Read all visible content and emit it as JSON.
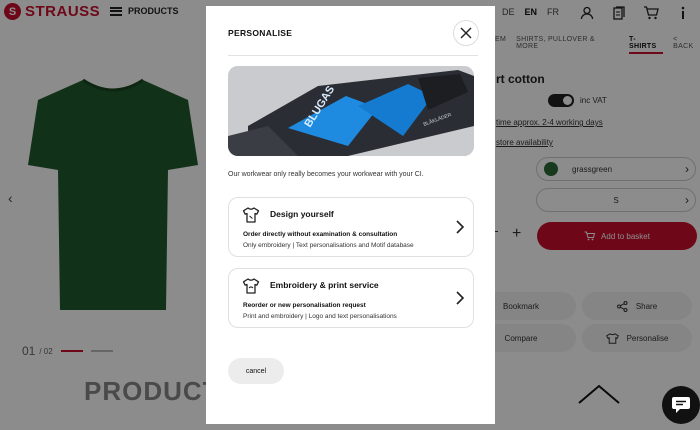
{
  "header": {
    "logo_mark": "S",
    "logo_text": "STRAUSS",
    "menu_label": "PRODUCTS",
    "languages": [
      {
        "label": "DE",
        "active": false
      },
      {
        "label": "EN",
        "active": true
      },
      {
        "label": "FR",
        "active": false
      }
    ],
    "icons": [
      "account-icon",
      "orders-icon",
      "cart-icon",
      "info-icon"
    ]
  },
  "breadcrumb": {
    "items": [
      "EM",
      "SHIRTS, PULLOVER & MORE",
      "T-SHIRTS"
    ],
    "back_label": "BACK"
  },
  "gallery": {
    "counter": "01",
    "counter_total": "/ 02",
    "colors": {
      "shirt": "#1f5a2e"
    }
  },
  "product": {
    "title": "rt cotton",
    "vat_label": "inc VAT",
    "delivery_link": "time approx. 2-4 working days",
    "availability_link": "store availability",
    "color_value": "grassgreen",
    "size_value": "S",
    "basket_label": "Add to basket",
    "bookmark_label": "Bookmark",
    "share_label": "Share",
    "compare_label": "Compare",
    "personalise_label": "Personalise"
  },
  "footer_heading": "PRODUCT",
  "modal": {
    "title": "PERSONALISE",
    "hero_brand": "BLÅKLÄDER",
    "hero_text": "BLUGAS",
    "intro": "Our workwear only really becomes your workwear with your CI.",
    "options": [
      {
        "title": "Design yourself",
        "subtitle": "Order directly without examination & consultation",
        "description": "Only embroidery | Text personalisations and Motif database",
        "icon": "tshirt-icon"
      },
      {
        "title": "Embroidery & print service",
        "subtitle": "Reorder or new personalisation request",
        "description": "Print and embroidery | Logo and text personalisations",
        "icon": "tshirt-icon"
      }
    ],
    "cancel_label": "cancel"
  },
  "colors": {
    "brand_red": "#c8102e",
    "overlay": "rgba(0,0,0,0.45)"
  }
}
